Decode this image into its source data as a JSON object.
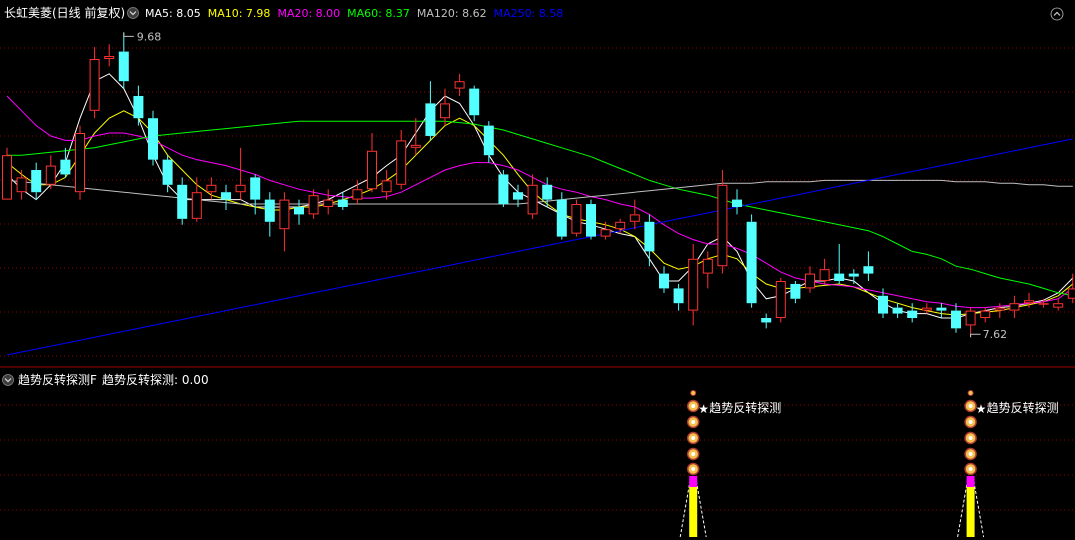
{
  "main_panel": {
    "title": "长虹美菱(日线 前复权)",
    "ma_legend": [
      {
        "label": "MA5: 8.05",
        "color": "#ffffff"
      },
      {
        "label": "MA10: 7.98",
        "color": "#ffff00"
      },
      {
        "label": "MA20: 8.00",
        "color": "#ff00ff"
      },
      {
        "label": "MA60: 8.37",
        "color": "#00ff00"
      },
      {
        "label": "MA120: 8.62",
        "color": "#c0c0c0"
      },
      {
        "label": "MA250: 8.58",
        "color": "#0000ff"
      }
    ],
    "high_marker": "9.68",
    "low_marker": "7.62"
  },
  "sub_panel": {
    "title": "趋势反转探测F",
    "value_label": "趋势反转探测: 0.00",
    "signal_label": "趋势反转探测",
    "signal_count": 2
  },
  "colors": {
    "up": "#ff3232",
    "down": "#54ffff",
    "ma5": "#ffffff",
    "ma10": "#ffff00",
    "ma20": "#ff00ff",
    "ma60": "#00ff00",
    "ma120": "#c0c0c0",
    "ma250": "#0000ff",
    "grid": "#8b0000",
    "signal_bar": "#ffff00",
    "signal_top": "#ff00ff"
  },
  "chart_data": {
    "type": "candlestick",
    "ylim": [
      7.5,
      9.75
    ],
    "candles": [
      [
        8.55,
        8.85,
        8.9,
        8.55
      ],
      [
        8.6,
        8.7,
        8.75,
        8.55
      ],
      [
        8.75,
        8.6,
        8.8,
        8.55
      ],
      [
        8.65,
        8.78,
        8.85,
        8.62
      ],
      [
        8.82,
        8.72,
        8.9,
        8.7
      ],
      [
        8.6,
        9.0,
        9.05,
        8.55
      ],
      [
        9.15,
        9.5,
        9.58,
        9.1
      ],
      [
        9.5,
        9.52,
        9.6,
        9.45
      ],
      [
        9.55,
        9.35,
        9.68,
        9.3
      ],
      [
        9.25,
        9.1,
        9.32,
        9.05
      ],
      [
        9.1,
        8.82,
        9.15,
        8.78
      ],
      [
        8.82,
        8.65,
        8.85,
        8.6
      ],
      [
        8.65,
        8.42,
        8.7,
        8.38
      ],
      [
        8.42,
        8.6,
        8.7,
        8.4
      ],
      [
        8.6,
        8.65,
        8.7,
        8.55
      ],
      [
        8.6,
        8.55,
        8.65,
        8.48
      ],
      [
        8.6,
        8.65,
        8.9,
        8.55
      ],
      [
        8.7,
        8.55,
        8.72,
        8.45
      ],
      [
        8.55,
        8.4,
        8.6,
        8.3
      ],
      [
        8.35,
        8.55,
        8.6,
        8.2
      ],
      [
        8.5,
        8.45,
        8.55,
        8.38
      ],
      [
        8.45,
        8.58,
        8.62,
        8.42
      ],
      [
        8.5,
        8.55,
        8.62,
        8.45
      ],
      [
        8.55,
        8.5,
        8.6,
        8.48
      ],
      [
        8.55,
        8.62,
        8.68,
        8.52
      ],
      [
        8.62,
        8.88,
        9.0,
        8.6
      ],
      [
        8.6,
        8.68,
        8.75,
        8.55
      ],
      [
        8.65,
        8.95,
        9.02,
        8.62
      ],
      [
        8.9,
        8.92,
        9.1,
        8.85
      ],
      [
        9.2,
        8.98,
        9.35,
        8.95
      ],
      [
        9.1,
        9.2,
        9.3,
        9.05
      ],
      [
        9.3,
        9.35,
        9.4,
        9.25
      ],
      [
        9.3,
        9.12,
        9.32,
        9.08
      ],
      [
        9.05,
        8.85,
        9.08,
        8.8
      ],
      [
        8.72,
        8.52,
        8.75,
        8.5
      ],
      [
        8.6,
        8.55,
        8.65,
        8.5
      ],
      [
        8.45,
        8.65,
        8.72,
        8.42
      ],
      [
        8.65,
        8.55,
        8.7,
        8.5
      ],
      [
        8.55,
        8.3,
        8.6,
        8.28
      ],
      [
        8.32,
        8.52,
        8.55,
        8.3
      ],
      [
        8.52,
        8.3,
        8.55,
        8.28
      ],
      [
        8.3,
        8.35,
        8.4,
        8.28
      ],
      [
        8.35,
        8.4,
        8.42,
        8.32
      ],
      [
        8.4,
        8.45,
        8.55,
        8.35
      ],
      [
        8.4,
        8.2,
        8.45,
        8.1
      ],
      [
        8.05,
        7.95,
        8.1,
        7.92
      ],
      [
        7.95,
        7.85,
        7.98,
        7.8
      ],
      [
        7.8,
        8.15,
        8.25,
        7.7
      ],
      [
        8.05,
        8.15,
        8.2,
        7.95
      ],
      [
        8.1,
        8.65,
        8.75,
        8.05
      ],
      [
        8.55,
        8.5,
        8.62,
        8.45
      ],
      [
        8.4,
        7.85,
        8.45,
        7.82
      ],
      [
        7.75,
        7.72,
        7.78,
        7.68
      ],
      [
        7.75,
        8.0,
        8.02,
        7.72
      ],
      [
        7.98,
        7.88,
        8.0,
        7.85
      ],
      [
        7.95,
        8.05,
        8.1,
        7.92
      ],
      [
        8.0,
        8.08,
        8.15,
        7.98
      ],
      [
        8.05,
        8.0,
        8.25,
        7.98
      ],
      [
        8.05,
        8.03,
        8.08,
        7.98
      ],
      [
        8.1,
        8.05,
        8.2,
        8.0
      ],
      [
        7.9,
        7.78,
        7.95,
        7.75
      ],
      [
        7.82,
        7.78,
        7.85,
        7.75
      ],
      [
        7.8,
        7.75,
        7.85,
        7.72
      ],
      [
        7.8,
        7.82,
        7.85,
        7.78
      ],
      [
        7.82,
        7.8,
        7.85,
        7.75
      ],
      [
        7.8,
        7.68,
        7.85,
        7.65
      ],
      [
        7.7,
        7.8,
        7.82,
        7.62
      ],
      [
        7.75,
        7.8,
        7.82,
        7.72
      ],
      [
        7.8,
        7.82,
        7.85,
        7.75
      ],
      [
        7.8,
        7.85,
        7.9,
        7.75
      ],
      [
        7.85,
        7.87,
        7.92,
        7.82
      ],
      [
        7.85,
        7.85,
        7.88,
        7.82
      ],
      [
        7.82,
        7.85,
        7.88,
        7.8
      ],
      [
        7.88,
        7.95,
        8.05,
        7.85
      ],
      [
        7.9,
        8.1,
        8.15,
        7.88
      ]
    ],
    "ma_series": [
      {
        "key": "ma5",
        "values": [
          8.72,
          8.62,
          8.55,
          8.65,
          8.8,
          9.1,
          9.35,
          9.4,
          9.3,
          9.1,
          8.85,
          8.65,
          8.55,
          8.55,
          8.55,
          8.55,
          8.55,
          8.5,
          8.5,
          8.5,
          8.5,
          8.52,
          8.55,
          8.6,
          8.65,
          8.7,
          8.78,
          8.85,
          9.0,
          9.15,
          9.25,
          9.2,
          9.05,
          8.85,
          8.7,
          8.6,
          8.55,
          8.5,
          8.45,
          8.4,
          8.38,
          8.35,
          8.32,
          8.3,
          8.15,
          8.0,
          8.0,
          8.1,
          8.25,
          8.3,
          8.2,
          8.0,
          7.88,
          7.9,
          7.95,
          8.0,
          8.0,
          8.02,
          8.0,
          7.92,
          7.85,
          7.8,
          7.78,
          7.78,
          7.75,
          7.75,
          7.78,
          7.8,
          7.82,
          7.83,
          7.85,
          7.87,
          7.92,
          8.02
        ]
      },
      {
        "key": "ma10",
        "values": [
          8.8,
          8.72,
          8.65,
          8.65,
          8.7,
          8.85,
          9.0,
          9.1,
          9.15,
          9.1,
          9.0,
          8.85,
          8.75,
          8.65,
          8.58,
          8.55,
          8.52,
          8.5,
          8.48,
          8.48,
          8.5,
          8.5,
          8.52,
          8.55,
          8.58,
          8.62,
          8.68,
          8.75,
          8.85,
          8.95,
          9.05,
          9.1,
          9.05,
          8.95,
          8.85,
          8.72,
          8.6,
          8.52,
          8.45,
          8.42,
          8.4,
          8.38,
          8.35,
          8.3,
          8.22,
          8.12,
          8.08,
          8.1,
          8.15,
          8.18,
          8.15,
          8.05,
          7.98,
          7.95,
          7.95,
          7.96,
          7.97,
          7.98,
          7.96,
          7.92,
          7.88,
          7.85,
          7.82,
          7.8,
          7.78,
          7.77,
          7.78,
          7.79,
          7.8,
          7.82,
          7.84,
          7.86,
          7.9,
          7.98
        ]
      },
      {
        "key": "ma20",
        "values": [
          9.25,
          9.15,
          9.05,
          8.98,
          8.95,
          8.95,
          8.98,
          9.0,
          9.0,
          8.98,
          8.95,
          8.9,
          8.85,
          8.82,
          8.8,
          8.78,
          8.75,
          8.72,
          8.68,
          8.65,
          8.62,
          8.6,
          8.58,
          8.57,
          8.56,
          8.56,
          8.57,
          8.6,
          8.65,
          8.7,
          8.75,
          8.78,
          8.8,
          8.8,
          8.78,
          8.75,
          8.7,
          8.65,
          8.62,
          8.6,
          8.57,
          8.55,
          8.52,
          8.5,
          8.45,
          8.38,
          8.32,
          8.28,
          8.25,
          8.25,
          8.22,
          8.18,
          8.12,
          8.06,
          8.02,
          8.0,
          7.98,
          7.97,
          7.96,
          7.94,
          7.92,
          7.9,
          7.88,
          7.86,
          7.85,
          7.83,
          7.82,
          7.82,
          7.83,
          7.84,
          7.85,
          7.86,
          7.88,
          7.95
        ]
      },
      {
        "key": "ma60",
        "values": [
          8.85,
          8.85,
          8.86,
          8.87,
          8.88,
          8.89,
          8.9,
          8.92,
          8.94,
          8.96,
          8.98,
          8.99,
          9.0,
          9.01,
          9.02,
          9.03,
          9.04,
          9.05,
          9.06,
          9.07,
          9.08,
          9.08,
          9.08,
          9.08,
          9.08,
          9.08,
          9.08,
          9.08,
          9.08,
          9.08,
          9.08,
          9.07,
          9.06,
          9.04,
          9.02,
          8.99,
          8.96,
          8.93,
          8.9,
          8.87,
          8.84,
          8.8,
          8.76,
          8.72,
          8.68,
          8.65,
          8.62,
          8.6,
          8.58,
          8.55,
          8.52,
          8.5,
          8.48,
          8.46,
          8.44,
          8.42,
          8.4,
          8.38,
          8.36,
          8.34,
          8.3,
          8.25,
          8.2,
          8.18,
          8.15,
          8.1,
          8.08,
          8.05,
          8.02,
          8.0,
          7.98,
          7.95,
          7.92,
          7.9
        ]
      },
      {
        "key": "ma120",
        "values": [
          8.68,
          8.67,
          8.66,
          8.65,
          8.64,
          8.63,
          8.62,
          8.61,
          8.6,
          8.59,
          8.58,
          8.57,
          8.56,
          8.55,
          8.54,
          8.53,
          8.52,
          8.52,
          8.52,
          8.52,
          8.52,
          8.52,
          8.52,
          8.52,
          8.52,
          8.52,
          8.52,
          8.52,
          8.52,
          8.52,
          8.52,
          8.52,
          8.52,
          8.52,
          8.52,
          8.52,
          8.53,
          8.54,
          8.55,
          8.56,
          8.57,
          8.58,
          8.59,
          8.6,
          8.61,
          8.62,
          8.63,
          8.64,
          8.65,
          8.66,
          8.66,
          8.66,
          8.67,
          8.67,
          8.67,
          8.67,
          8.68,
          8.68,
          8.68,
          8.68,
          8.68,
          8.68,
          8.68,
          8.68,
          8.68,
          8.67,
          8.67,
          8.67,
          8.66,
          8.66,
          8.65,
          8.65,
          8.64,
          8.64
        ]
      },
      {
        "key": "ma250",
        "values": [
          7.5,
          7.52,
          7.54,
          7.56,
          7.58,
          7.6,
          7.62,
          7.64,
          7.66,
          7.68,
          7.7,
          7.72,
          7.74,
          7.76,
          7.78,
          7.8,
          7.82,
          7.84,
          7.86,
          7.88,
          7.9,
          7.92,
          7.94,
          7.96,
          7.98,
          8.0,
          8.02,
          8.04,
          8.06,
          8.08,
          8.1,
          8.12,
          8.14,
          8.16,
          8.18,
          8.2,
          8.22,
          8.24,
          8.26,
          8.28,
          8.3,
          8.32,
          8.34,
          8.36,
          8.38,
          8.4,
          8.42,
          8.44,
          8.46,
          8.48,
          8.5,
          8.52,
          8.54,
          8.56,
          8.58,
          8.6,
          8.62,
          8.64,
          8.66,
          8.68,
          8.7,
          8.72,
          8.74,
          8.76,
          8.78,
          8.8,
          8.82,
          8.84,
          8.86,
          8.88,
          8.9,
          8.92,
          8.94,
          8.96
        ]
      }
    ],
    "signals": [
      47,
      66
    ]
  }
}
